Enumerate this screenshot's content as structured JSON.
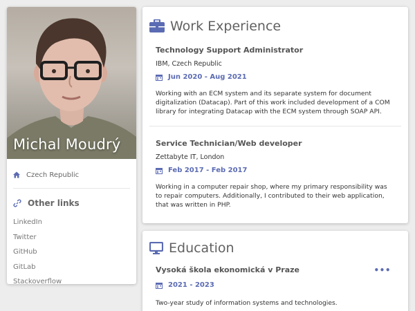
{
  "profile": {
    "name": "Michal Moudrý",
    "location": "Czech Republic",
    "other_links_title": "Other links",
    "links": [
      "LinkedIn",
      "Twitter",
      "GitHub",
      "GitLab",
      "Stackoverflow"
    ]
  },
  "work": {
    "title": "Work Experience",
    "entries": [
      {
        "role": "Technology Support Administrator",
        "company": "IBM, Czech Republic",
        "dates": "Jun 2020 - Aug 2021",
        "description": "Working with an ECM system and its separate system for document digitalization (Datacap). Part of this work included development of a COM library for integrating Datacap with the ECM system through SOAP API."
      },
      {
        "role": "Service Technician/Web developer",
        "company": "Zettabyte IT, London",
        "dates": "Feb 2017 - Feb 2017",
        "description": "Working in a computer repair shop, where my primary responsibility was to repair computers. Additionally, I contributed to their web application, that was written in PHP."
      }
    ]
  },
  "education": {
    "title": "Education",
    "entries": [
      {
        "school": "Vysoká škola ekonomická v Praze",
        "dates": "2021 - 2023",
        "description": "Two-year study of information systems and technologies.",
        "more": "•••"
      }
    ]
  },
  "colors": {
    "accent": "#5b6bb3",
    "heading": "#616161",
    "background": "#ededed"
  },
  "icons": {
    "location": "home-icon",
    "links": "link-icon",
    "work": "briefcase-icon",
    "date": "calendar-icon",
    "education": "monitor-icon"
  }
}
